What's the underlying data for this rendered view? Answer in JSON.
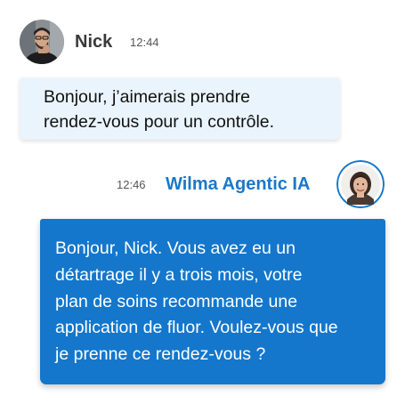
{
  "nick": {
    "name": "Nick",
    "time": "12:44",
    "message_lines": [
      "Bonjour, j’aimerais prendre",
      "rendez-vous pour un contrôle."
    ]
  },
  "assistant": {
    "name": "Wilma Agentic IA",
    "time": "12:46",
    "message_lines": [
      "Bonjour, Nick. Vous avez eu un",
      "détartrage il y a trois mois, votre",
      "plan de soins recommande une",
      "application de fluor. Voulez-vous que",
      "je prenne ce rendez-vous ?"
    ]
  },
  "colors": {
    "assistant_accent": "#1477cc",
    "user_bubble": "#eaf4fc"
  }
}
